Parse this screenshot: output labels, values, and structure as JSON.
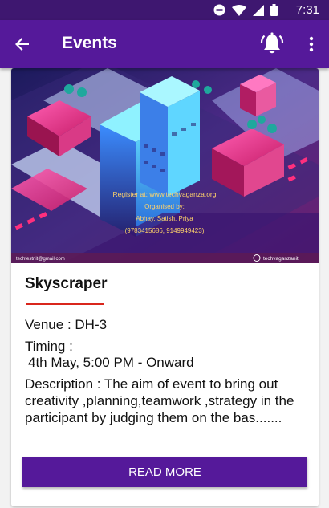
{
  "status_bar": {
    "time": "7:31",
    "icons": [
      "do-not-disturb-icon",
      "wifi-icon",
      "signal-icon",
      "battery-icon"
    ]
  },
  "app_bar": {
    "title": "Events",
    "icons": [
      "back-arrow-icon",
      "notification-bell-icon",
      "more-vert-icon"
    ]
  },
  "poster": {
    "register_line": "Register at: www.techvaganza.org",
    "organized_by": "Organised by:",
    "organizers": "Abhay, Satish, Priya",
    "phones": "(9783415686, 9149949423)",
    "email": "techfestnit@gmail.com",
    "handle": "techvaganzanit"
  },
  "event": {
    "name": "Skyscraper",
    "venue": "Venue :  DH-3",
    "timing_label": "Timing :",
    "timing_value": "4th May, 5:00 PM - Onward",
    "description": "Description :  The aim of event to bring out creativity ,planning,teamwork ,strategy in the participant by judging them on the bas.......",
    "read_more_label": "READ MORE"
  },
  "colors": {
    "primary": "#55199a",
    "status_bar": "#3e1770",
    "accent": "#d9261c"
  }
}
